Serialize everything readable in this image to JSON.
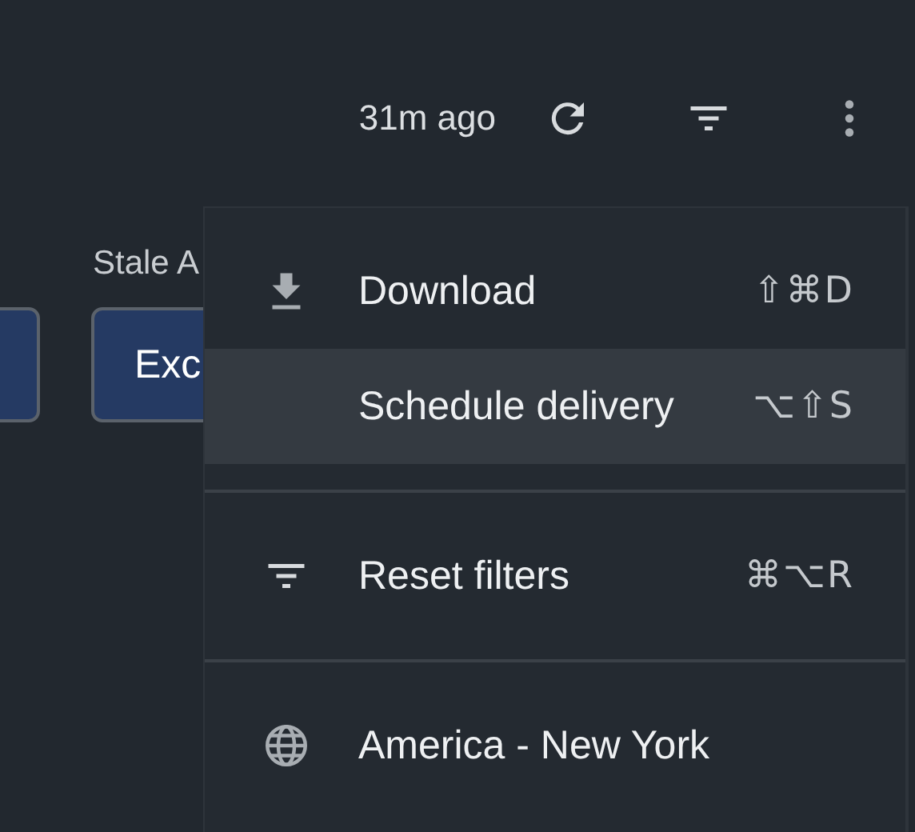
{
  "toolbar": {
    "updated": "31m ago"
  },
  "filters": {
    "label": "Stale A",
    "buttons": [
      {
        "kind": "blank"
      },
      {
        "kind": "text",
        "label": "Exc"
      }
    ]
  },
  "menu": {
    "groups": [
      [
        {
          "label": "Download",
          "shortcut": "⇧⌘D",
          "highlighted": false
        },
        {
          "label": "Schedule delivery",
          "shortcut": "⌥⇧S",
          "highlighted": true
        }
      ],
      [
        {
          "label": "Reset filters",
          "shortcut": "⌘⌥R",
          "highlighted": false
        }
      ],
      [
        {
          "label": "America - New York",
          "highlighted": false
        }
      ]
    ]
  }
}
